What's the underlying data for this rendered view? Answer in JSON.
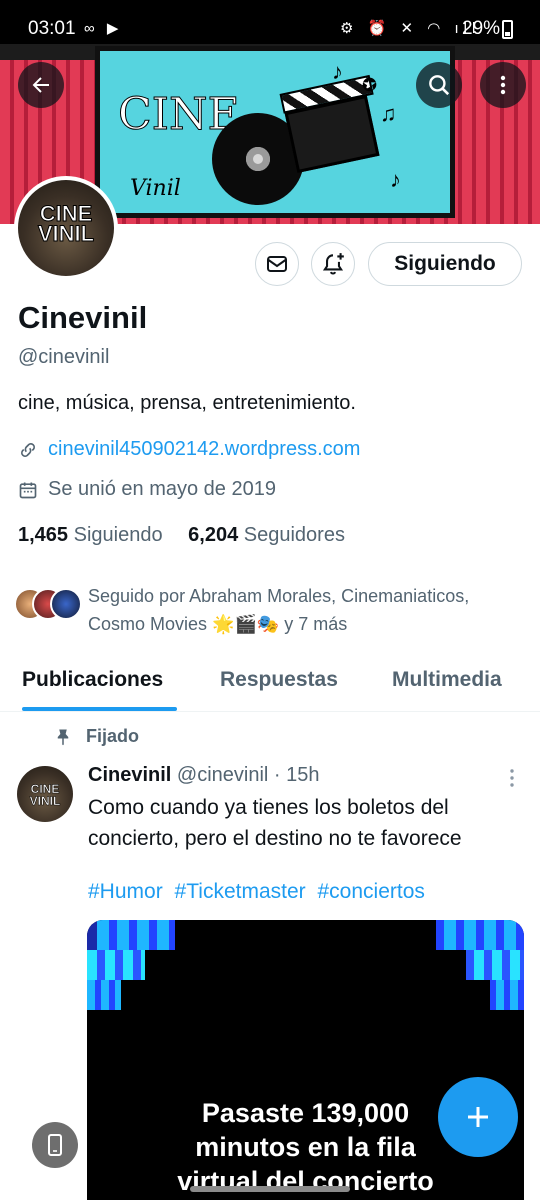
{
  "status_bar": {
    "time": "03:01",
    "left_icons": "∞ ▶",
    "right_icons": "⚙ ⏰ ✕ ◠ ıll",
    "battery": "29%"
  },
  "banner": {
    "logo_text": "CINE",
    "logo_script": "Vinil"
  },
  "avatar": {
    "line1": "CINE",
    "line2": "VINIL"
  },
  "actions": {
    "follow_label": "Siguiendo"
  },
  "profile": {
    "name": "Cinevinil",
    "handle": "@cinevinil",
    "bio": "cine, música, prensa, entretenimiento.",
    "website": "cinevinil450902142.wordpress.com",
    "joined": "Se unió en mayo de 2019"
  },
  "counts": {
    "following_num": "1,465",
    "following_label": "Siguiendo",
    "followers_num": "6,204",
    "followers_label": "Seguidores"
  },
  "followed_by": {
    "line1": "Seguido por Abraham Morales, Cinemaniaticos,",
    "line2": "Cosmo Movies 🌟🎬🎭 y 7 más"
  },
  "tabs": [
    {
      "label": "Publicaciones"
    },
    {
      "label": "Respuestas"
    },
    {
      "label": "Multimedia"
    }
  ],
  "post": {
    "pinned_label": "Fijado",
    "author": "Cinevinil",
    "handle_time": "@cinevinil · 15h",
    "text": "Como cuando ya tienes los boletos del concierto, pero el destino no te favorece",
    "hashtags": [
      "#Humor",
      "#Ticketmaster",
      "#conciertos"
    ],
    "media_text_line1": "Pasaste 139,000",
    "media_text_line2": "minutos en la fila",
    "media_text_line3": "virtual del concierto"
  },
  "colors": {
    "accent": "#1d9bf0",
    "secondary_text": "#536471",
    "primary_text": "#0f1419"
  }
}
